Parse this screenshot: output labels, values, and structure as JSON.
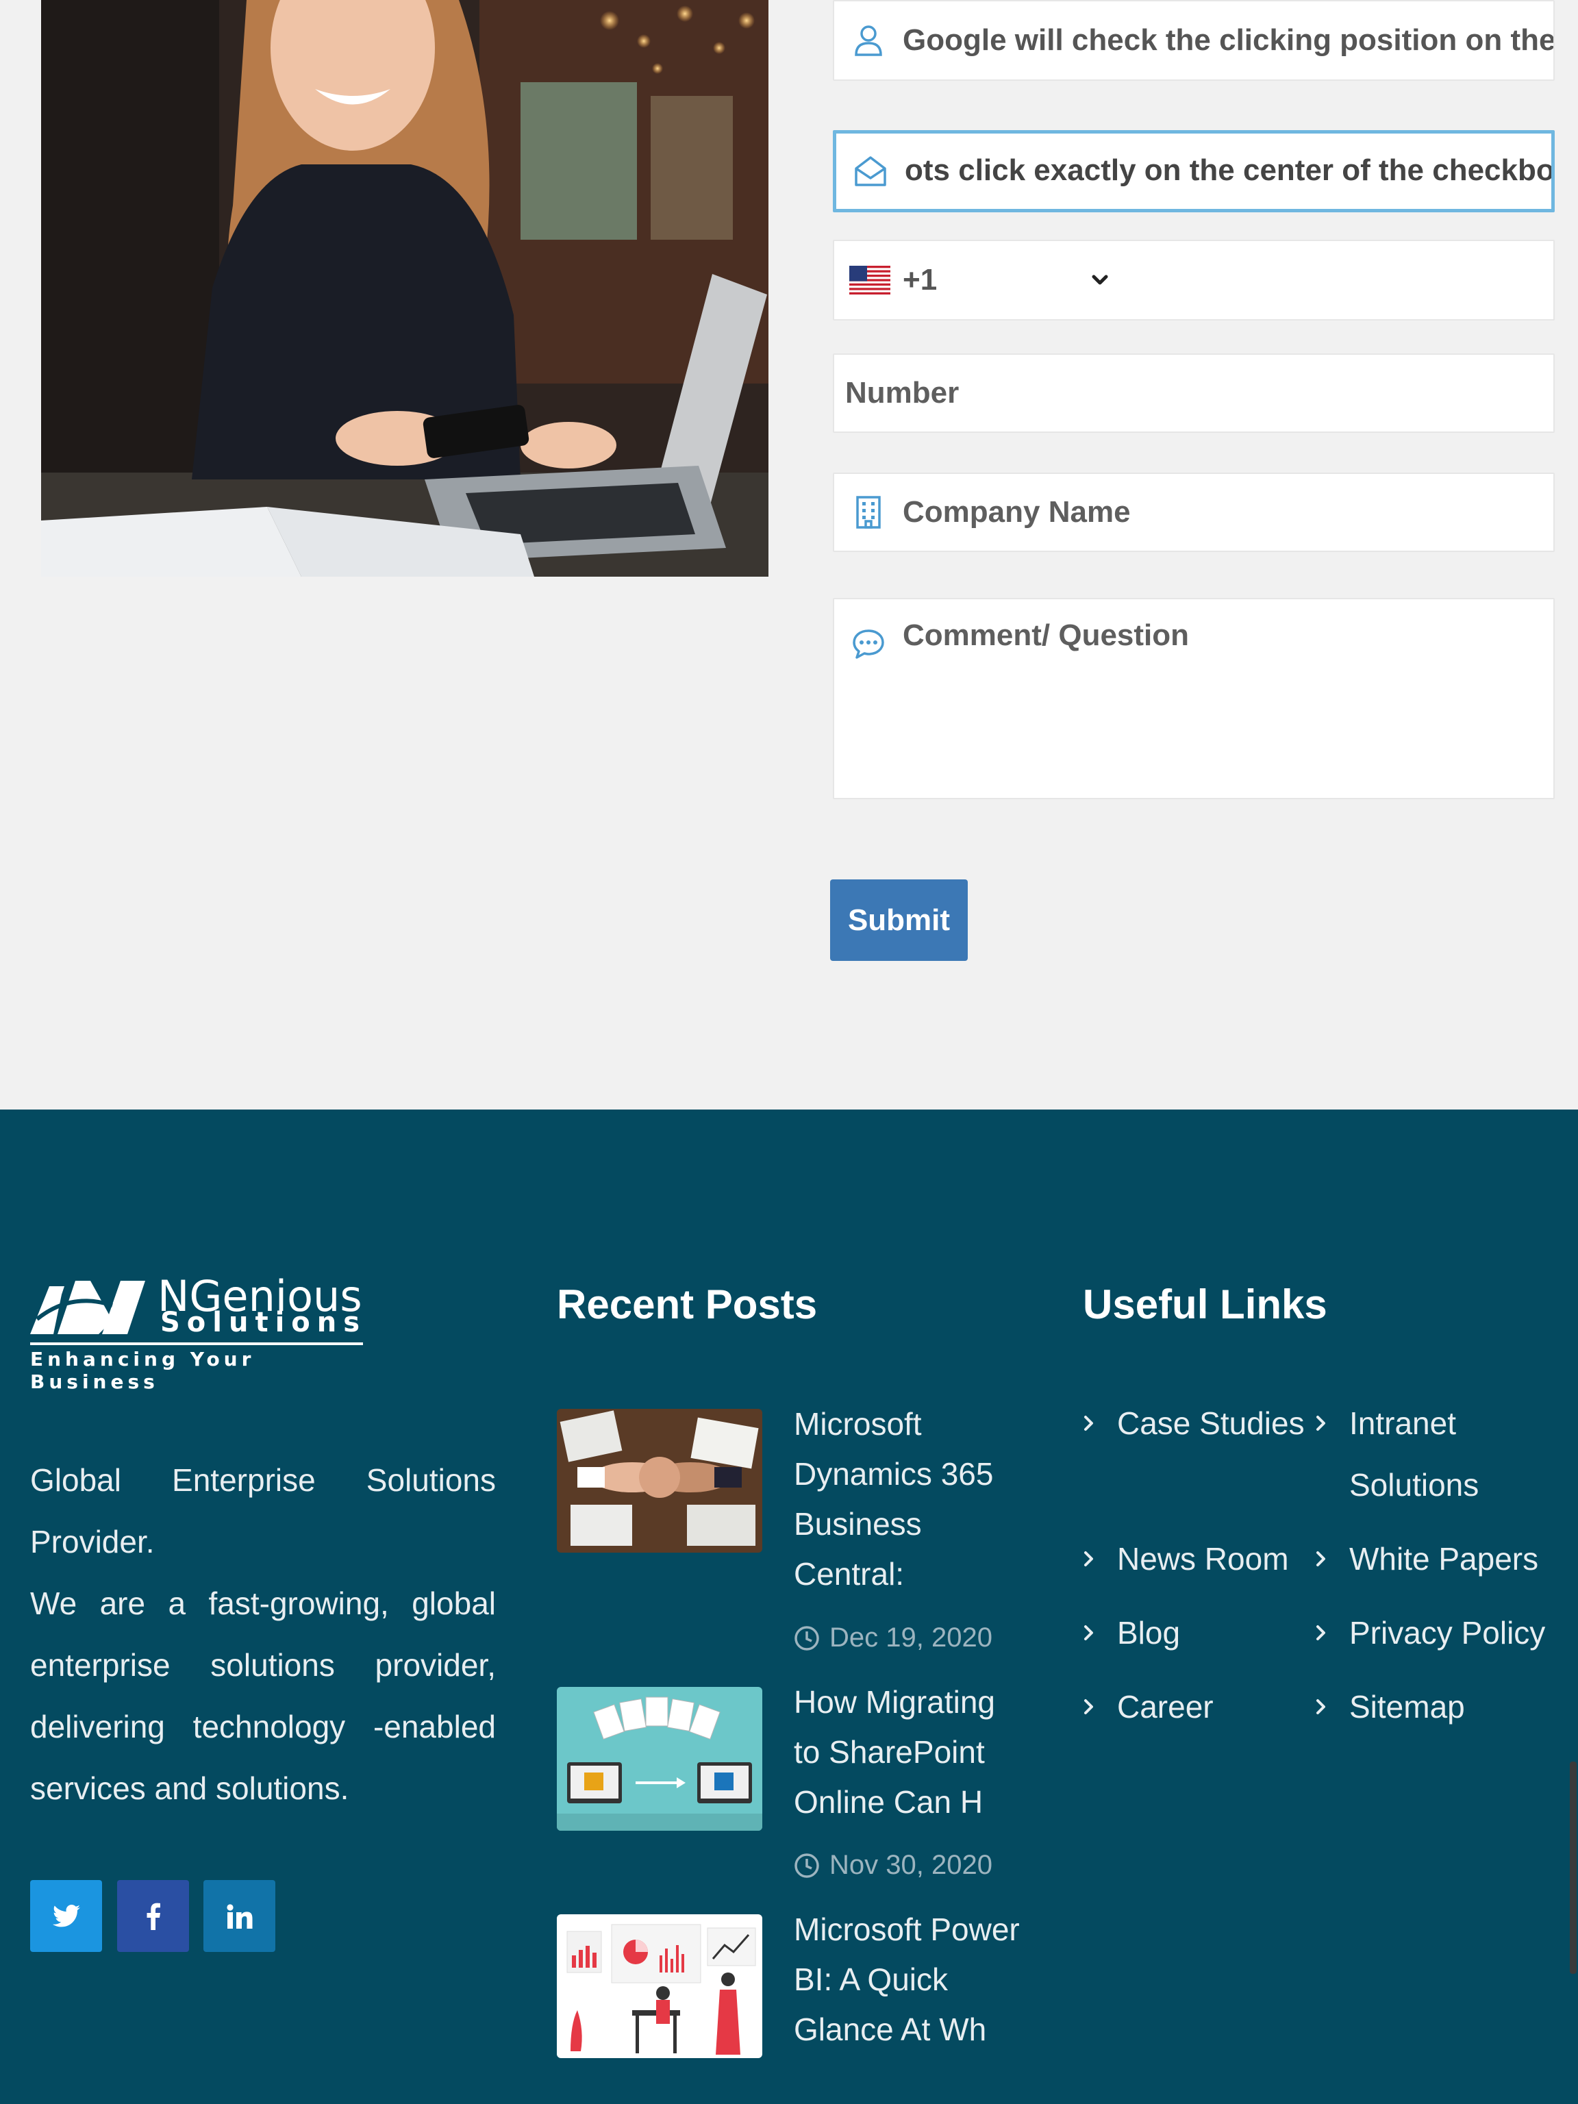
{
  "form": {
    "name_value": "Google will check the clicking position on the c",
    "email_value": "ots click exactly on the center of the checkbox",
    "phone_country_code": "+1",
    "number_placeholder": "Number",
    "company_placeholder": "Company Name",
    "comment_placeholder": "Comment/ Question",
    "submit_label": "Submit"
  },
  "footer": {
    "logo": {
      "line1": "NGenious",
      "line2": "Solutions",
      "tagline": "Enhancing Your Business"
    },
    "about_line1": "Global Enterprise Solutions Provider.",
    "about_line2": "We are a fast-growing, global enterprise solutions provider, delivering technology -enabled services and solutions.",
    "recent_posts_title": "Recent Posts",
    "useful_links_title": "Useful Links",
    "posts": [
      {
        "title": "Microsoft Dynamics 365 Business Central:",
        "date": "Dec 19, 2020"
      },
      {
        "title": "How Migrating to SharePoint Online Can H",
        "date": "Nov 30, 2020"
      },
      {
        "title": "Microsoft Power BI: A Quick Glance At Wh",
        "date": ""
      }
    ],
    "links": [
      "Case Studies",
      "Intranet Solutions",
      "News Room",
      "White Papers",
      "Blog",
      "Privacy Policy",
      "Career",
      "Sitemap"
    ]
  },
  "colors": {
    "footer_bg": "#044a60",
    "submit_bg": "#3c78b5",
    "focus_border": "#6fb7e0",
    "twitter": "#1b95e0",
    "facebook": "#2a4fa3",
    "linkedin": "#1173a8"
  },
  "icons": {
    "name_field": "user-icon",
    "email_field": "envelope-open-icon",
    "company_field": "building-icon",
    "comment_field": "chat-bubble-icon",
    "post_date": "clock-icon",
    "link_bullet": "chevron-right-icon"
  }
}
